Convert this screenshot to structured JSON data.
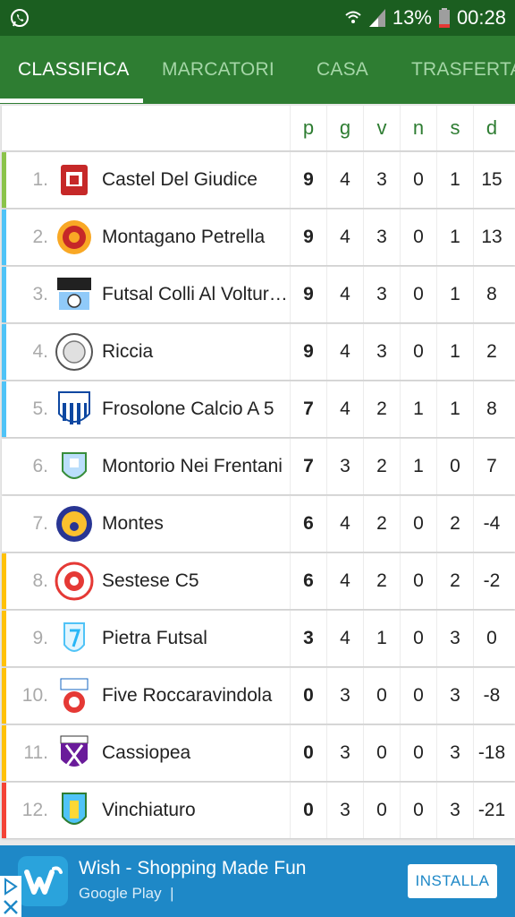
{
  "status_bar": {
    "battery": "13%",
    "time": "00:28",
    "notification_icon": "whatsapp-icon"
  },
  "tabs": [
    {
      "label": "CLASSIFICA",
      "active": true
    },
    {
      "label": "MARCATORI",
      "active": false
    },
    {
      "label": "CASA",
      "active": false
    },
    {
      "label": "TRASFERTA",
      "active": false
    }
  ],
  "table": {
    "columns": [
      "p",
      "g",
      "v",
      "n",
      "s",
      "d"
    ],
    "rows": [
      {
        "pos": "1.",
        "team": "Castel Del Giudice",
        "p": "9",
        "g": "4",
        "v": "3",
        "n": "0",
        "s": "1",
        "d": "15",
        "zone_color": "#8bc34a"
      },
      {
        "pos": "2.",
        "team": "Montagano Petrella",
        "p": "9",
        "g": "4",
        "v": "3",
        "n": "0",
        "s": "1",
        "d": "13",
        "zone_color": "#4fc3f7"
      },
      {
        "pos": "3.",
        "team": "Futsal Colli Al Volturno",
        "p": "9",
        "g": "4",
        "v": "3",
        "n": "0",
        "s": "1",
        "d": "8",
        "zone_color": "#4fc3f7"
      },
      {
        "pos": "4.",
        "team": "Riccia",
        "p": "9",
        "g": "4",
        "v": "3",
        "n": "0",
        "s": "1",
        "d": "2",
        "zone_color": "#4fc3f7"
      },
      {
        "pos": "5.",
        "team": "Frosolone Calcio A 5",
        "p": "7",
        "g": "4",
        "v": "2",
        "n": "1",
        "s": "1",
        "d": "8",
        "zone_color": "#4fc3f7"
      },
      {
        "pos": "6.",
        "team": "Montorio Nei Frentani",
        "p": "7",
        "g": "3",
        "v": "2",
        "n": "1",
        "s": "0",
        "d": "7",
        "zone_color": "#ffffff"
      },
      {
        "pos": "7.",
        "team": "Montes",
        "p": "6",
        "g": "4",
        "v": "2",
        "n": "0",
        "s": "2",
        "d": "-4",
        "zone_color": "#ffffff"
      },
      {
        "pos": "8.",
        "team": "Sestese C5",
        "p": "6",
        "g": "4",
        "v": "2",
        "n": "0",
        "s": "2",
        "d": "-2",
        "zone_color": "#ffc107"
      },
      {
        "pos": "9.",
        "team": "Pietra Futsal",
        "p": "3",
        "g": "4",
        "v": "1",
        "n": "0",
        "s": "3",
        "d": "0",
        "zone_color": "#ffc107"
      },
      {
        "pos": "10.",
        "team": "Five Roccaravindola",
        "p": "0",
        "g": "3",
        "v": "0",
        "n": "0",
        "s": "3",
        "d": "-8",
        "zone_color": "#ffc107"
      },
      {
        "pos": "11.",
        "team": "Cassiopea",
        "p": "0",
        "g": "3",
        "v": "0",
        "n": "0",
        "s": "3",
        "d": "-18",
        "zone_color": "#ffc107"
      },
      {
        "pos": "12.",
        "team": "Vinchiaturo",
        "p": "0",
        "g": "3",
        "v": "0",
        "n": "0",
        "s": "3",
        "d": "-21",
        "zone_color": "#f44336"
      }
    ]
  },
  "ad": {
    "title": "Wish - Shopping Made Fun",
    "store": "Google Play",
    "cta": "INSTALLA"
  },
  "colors": {
    "status_bar": "#1b5e20",
    "tab_bar": "#2e7d32",
    "accent_green": "#2e7d32",
    "ad_blue": "#1e88c7"
  }
}
